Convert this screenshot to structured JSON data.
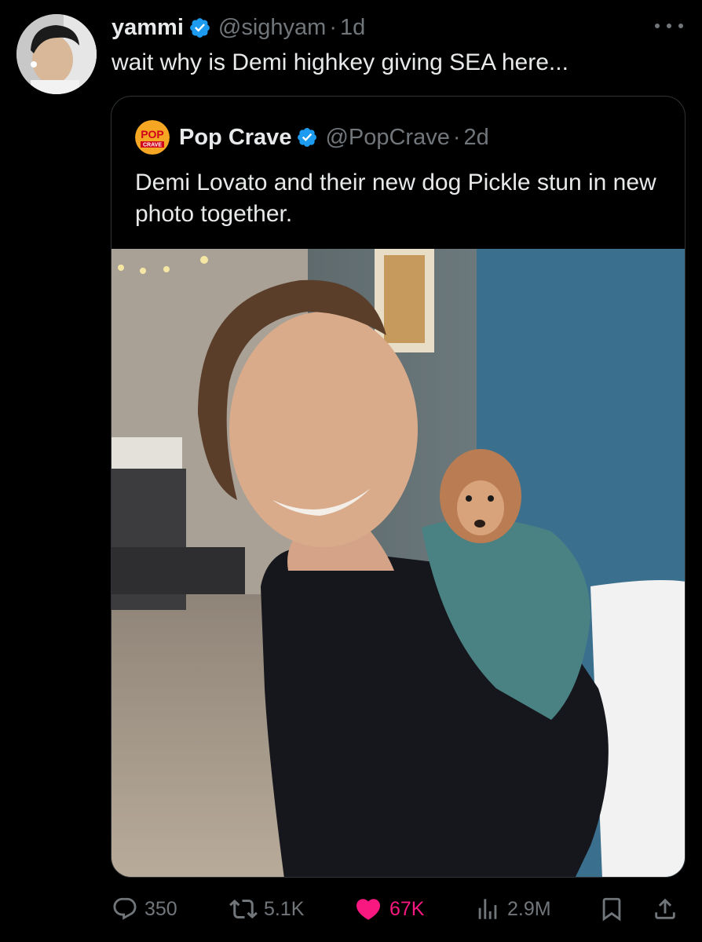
{
  "post": {
    "author": {
      "display_name": "yammi",
      "handle": "@sighyam",
      "time": "1d",
      "avatar_icon": "user-avatar"
    },
    "text": "wait why is Demi highkey giving SEA here...",
    "separator": "·"
  },
  "quoted": {
    "author": {
      "display_name": "Pop Crave",
      "handle": "@PopCrave",
      "time": "2d",
      "logo_icon": "pop-crave-logo",
      "logo_text_top": "POP",
      "logo_text_bottom": "CRAVE"
    },
    "text": "Demi Lovato and their new dog Pickle stun in new photo together.",
    "media_icon": "photo-demi-with-dog"
  },
  "actions": {
    "replies": "350",
    "reposts": "5.1K",
    "likes": "67K",
    "views": "2.9M"
  },
  "colors": {
    "background": "#000000",
    "text_primary": "#e7e9ea",
    "text_secondary": "#71767b",
    "verified_blue": "#1d9bf0",
    "like_pink": "#f91880",
    "border": "#2f3336"
  }
}
